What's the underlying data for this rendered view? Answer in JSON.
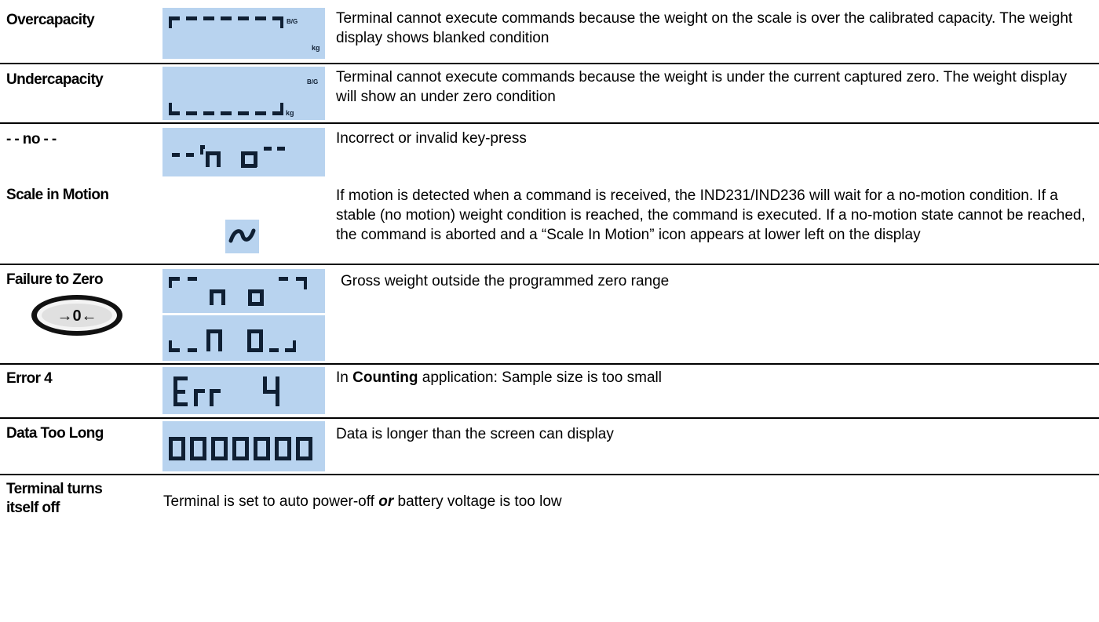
{
  "rows": [
    {
      "label": "Overcapacity",
      "description": "Terminal cannot execute commands because the weight on the scale is over the calibrated capacity. The weight display shows blanked condition",
      "display_annotations": [
        "B/G",
        "kg"
      ]
    },
    {
      "label": "Undercapacity",
      "description": "Terminal cannot execute commands because the weight is under the current captured zero. The weight display will show an under zero condition",
      "display_annotations": [
        "B/G",
        "kg"
      ]
    },
    {
      "label": "- - no - -",
      "description": "Incorrect or invalid key-press"
    },
    {
      "label": "Scale in Motion",
      "description": "If motion is detected when a command is received, the IND231/IND236 will wait for a no-motion condition. If a stable (no motion) weight condition is reached, the command is executed. If a no-motion state cannot be reached, the command is aborted and a “Scale In Motion” icon appears at lower left on the display",
      "icon": "motion-tilde-icon"
    },
    {
      "label": "Failure to Zero",
      "description": "Gross weight outside the programmed zero range",
      "icon": "center-of-zero-icon",
      "icon_text": "→0←"
    },
    {
      "label": "Error 4",
      "description_prefix": "In ",
      "description_bold": "Counting",
      "description_suffix": " application: Sample size is too small"
    },
    {
      "label": "Data Too Long",
      "description": "Data is longer than the screen can display"
    },
    {
      "label_line1": "Terminal turns",
      "label_line2": "itself off",
      "description_prefix": "Terminal is set to auto power-off ",
      "description_emphasis": "or",
      "description_suffix": " battery voltage is too low"
    }
  ],
  "colors": {
    "lcd_background": "#b8d3ef",
    "lcd_segment": "#0f1f33"
  }
}
